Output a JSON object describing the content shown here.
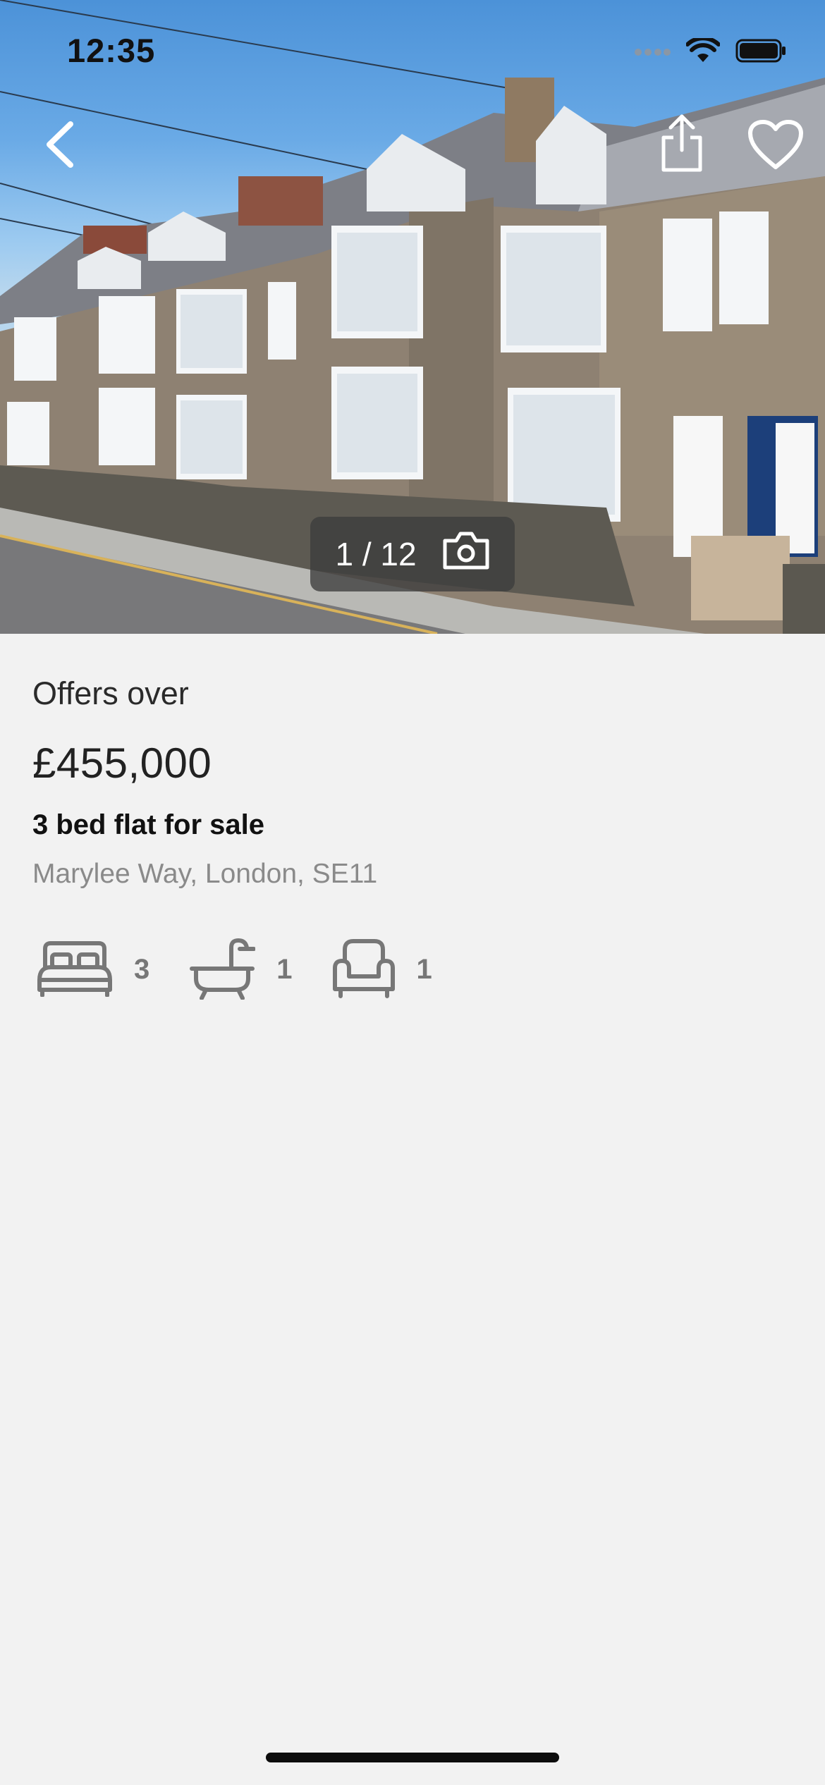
{
  "status_bar": {
    "time": "12:35",
    "icons": [
      "signal-icon",
      "wifi-icon",
      "battery-icon"
    ]
  },
  "gallery": {
    "counter": "1 / 12",
    "icons": [
      "chevron-left-icon",
      "share-icon",
      "heart-icon",
      "camera-icon"
    ]
  },
  "listing": {
    "price_qualifier": "Offers over",
    "price": "£455,000",
    "title": "3 bed flat for sale",
    "address": "Marylee Way, London, SE11"
  },
  "features": [
    {
      "icon": "bed-icon",
      "count": "3"
    },
    {
      "icon": "bath-icon",
      "count": "1"
    },
    {
      "icon": "armchair-icon",
      "count": "1"
    }
  ],
  "colors": {
    "background": "#f2f2f2",
    "muted_text": "#8a8a8a",
    "icon_gray": "#777777",
    "counter_bg": "#3c3c3c"
  }
}
